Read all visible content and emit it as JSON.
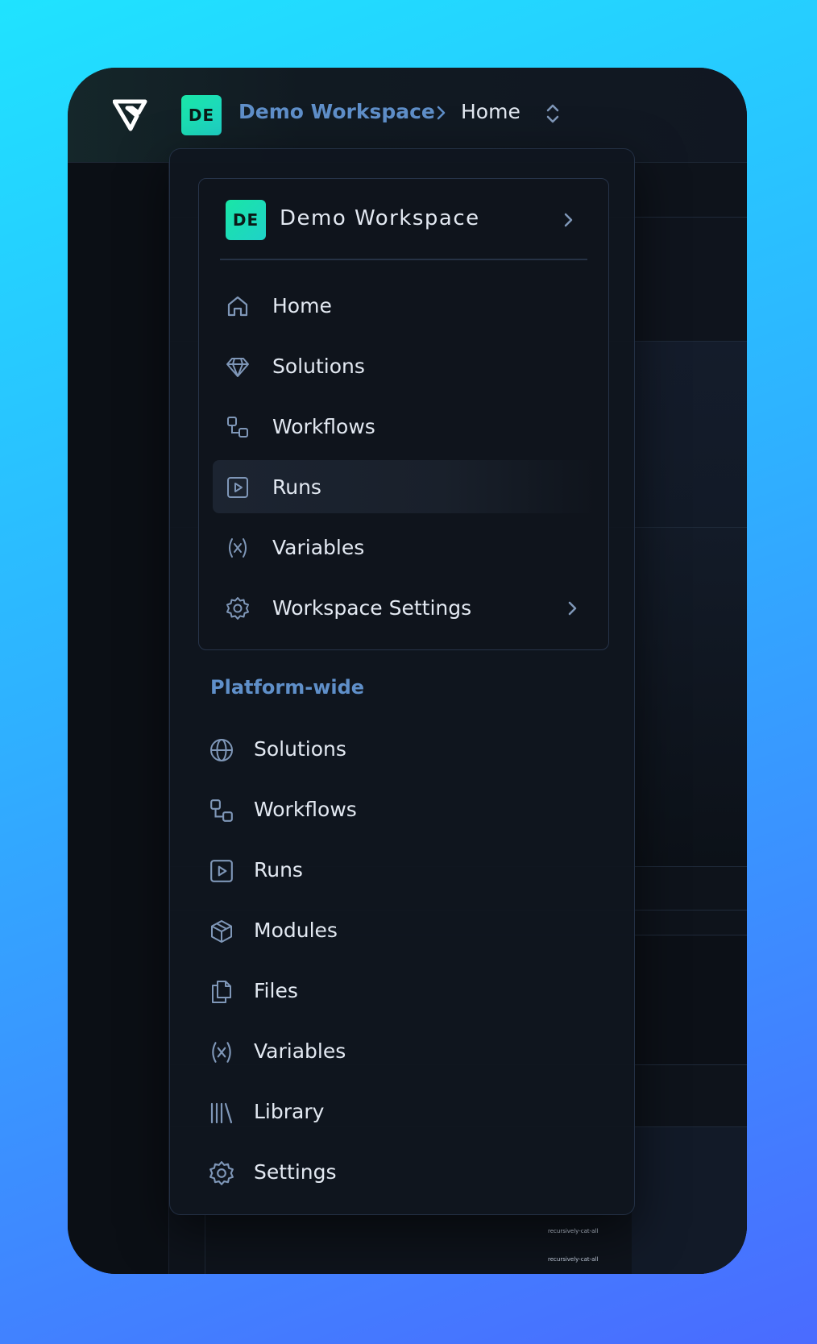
{
  "header": {
    "workspace_badge": "DE",
    "breadcrumb_workspace": "Demo Workspace",
    "breadcrumb_page": "Home"
  },
  "dropdown": {
    "workspace": {
      "badge": "DE",
      "name": "Demo Workspace"
    },
    "workspace_items": [
      {
        "label": "Home",
        "icon": "home-icon"
      },
      {
        "label": "Solutions",
        "icon": "diamond-icon"
      },
      {
        "label": "Workflows",
        "icon": "workflow-icon"
      },
      {
        "label": "Runs",
        "icon": "play-icon",
        "active": true
      },
      {
        "label": "Variables",
        "icon": "variable-icon"
      },
      {
        "label": "Workspace Settings",
        "icon": "gear-icon",
        "has_submenu": true
      }
    ],
    "platform_section_title": "Platform-wide",
    "platform_items": [
      {
        "label": "Solutions",
        "icon": "globe-icon"
      },
      {
        "label": "Workflows",
        "icon": "workflow-icon"
      },
      {
        "label": "Runs",
        "icon": "play-icon"
      },
      {
        "label": "Modules",
        "icon": "package-icon"
      },
      {
        "label": "Files",
        "icon": "files-icon"
      },
      {
        "label": "Variables",
        "icon": "variable-icon"
      },
      {
        "label": "Library",
        "icon": "library-icon"
      },
      {
        "label": "Settings",
        "icon": "gear-icon"
      }
    ]
  },
  "background": {
    "node_labels": [
      "recursively-cat-all",
      "recursively-cat-all"
    ]
  },
  "colors": {
    "accent": "#5f8fc9",
    "badge": "#19e6a6",
    "text": "#e3e9f2",
    "icon": "#7f97b8"
  }
}
